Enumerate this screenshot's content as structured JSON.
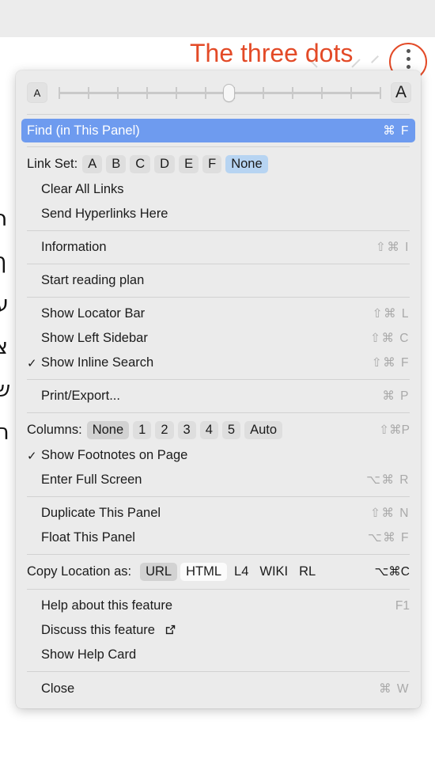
{
  "annotation": {
    "text": "The three dots",
    "color": "#e34a27",
    "icon_name": "three-dots-icon"
  },
  "background": {
    "hebrew_text": "ר\nך\nע\nצ\nש\nה"
  },
  "font_slider": {
    "small_label": "A",
    "large_label": "A",
    "tick_count": 12,
    "thumb_percent": 53
  },
  "menu": {
    "find": {
      "label": "Find (in This Panel)",
      "shortcut": "⌘ F",
      "highlighted": true
    },
    "link_set": {
      "label": "Link Set:",
      "options": [
        "A",
        "B",
        "C",
        "D",
        "E",
        "F",
        "None"
      ],
      "selected": "None"
    },
    "clear_all_links": {
      "label": "Clear All Links",
      "shortcut": ""
    },
    "send_hyperlinks": {
      "label": "Send Hyperlinks Here",
      "shortcut": ""
    },
    "information": {
      "label": "Information",
      "shortcut": "⇧⌘ I"
    },
    "start_reading_plan": {
      "label": "Start reading plan",
      "shortcut": ""
    },
    "show_locator_bar": {
      "label": "Show Locator Bar",
      "shortcut": "⇧⌘ L",
      "checked": false
    },
    "show_left_sidebar": {
      "label": "Show Left Sidebar",
      "shortcut": "⇧⌘ C",
      "checked": false
    },
    "show_inline_search": {
      "label": "Show Inline Search",
      "shortcut": "⇧⌘ F",
      "checked": true,
      "check_glyph": "✓"
    },
    "print_export": {
      "label": "Print/Export...",
      "shortcut": "⌘ P"
    },
    "columns": {
      "label": "Columns:",
      "options": [
        "None",
        "1",
        "2",
        "3",
        "4",
        "5",
        "Auto"
      ],
      "selected": "None",
      "shortcut": "⇧⌘P"
    },
    "show_footnotes": {
      "label": "Show Footnotes on Page",
      "shortcut": "",
      "checked": true,
      "check_glyph": "✓"
    },
    "enter_full_screen": {
      "label": "Enter Full Screen",
      "shortcut": "⌥⌘ R"
    },
    "duplicate_panel": {
      "label": "Duplicate This Panel",
      "shortcut": "⇧⌘ N"
    },
    "float_panel": {
      "label": "Float This Panel",
      "shortcut": "⌥⌘ F"
    },
    "copy_location": {
      "label": "Copy Location as:",
      "options": [
        "URL",
        "HTML",
        "L4",
        "WIKI",
        "RL"
      ],
      "selected": "URL",
      "hovered": "HTML",
      "shortcut": "⌥⌘C"
    },
    "help_about": {
      "label": "Help about this feature",
      "shortcut": "F1"
    },
    "discuss": {
      "label": "Discuss this feature",
      "shortcut": "",
      "icon": "external-link-icon"
    },
    "show_help_card": {
      "label": "Show Help Card",
      "shortcut": ""
    },
    "close": {
      "label": "Close",
      "shortcut": "⌘ W"
    }
  }
}
